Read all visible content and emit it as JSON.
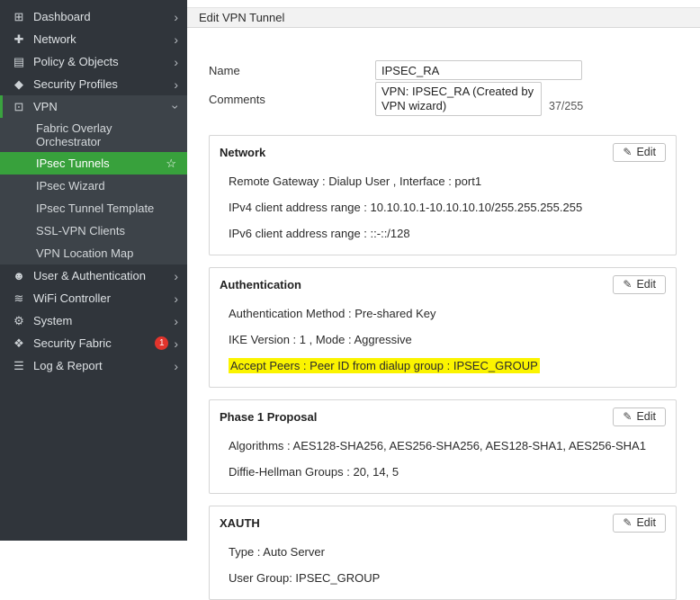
{
  "colors": {
    "sidebar_bg": "#30353b",
    "submenu_bg": "#3d4349",
    "selected_green": "#38a13c",
    "accent_green": "#3aa23f",
    "badge_red": "#e2342c",
    "highlight_yellow": "#fbf400"
  },
  "icons": {
    "dashboard": "⊞",
    "network": "✚",
    "policy": "▤",
    "security_profiles": "◆",
    "vpn": "⊡",
    "user_auth": "☻",
    "wifi": "≋",
    "system": "⚙",
    "security_fabric": "❖",
    "log_report": "☰",
    "chevron": "›",
    "star": "☆",
    "pencil": "✎"
  },
  "sidebar": {
    "items": [
      {
        "label": "Dashboard"
      },
      {
        "label": "Network"
      },
      {
        "label": "Policy & Objects"
      },
      {
        "label": "Security Profiles"
      },
      {
        "label": "VPN"
      },
      {
        "label": "User & Authentication"
      },
      {
        "label": "WiFi Controller"
      },
      {
        "label": "System"
      },
      {
        "label": "Security Fabric",
        "badge": "1"
      },
      {
        "label": "Log & Report"
      }
    ],
    "vpn_submenu": [
      {
        "label": "Fabric Overlay Orchestrator"
      },
      {
        "label": "IPsec Tunnels",
        "selected": true
      },
      {
        "label": "IPsec Wizard"
      },
      {
        "label": "IPsec Tunnel Template"
      },
      {
        "label": "SSL-VPN Clients"
      },
      {
        "label": "VPN Location Map"
      }
    ]
  },
  "header": {
    "title": "Edit VPN Tunnel"
  },
  "form": {
    "name_label": "Name",
    "name_value": "IPSEC_RA",
    "comments_label": "Comments",
    "comments_value": "VPN: IPSEC_RA (Created by VPN wizard)",
    "comments_counter": "37/255"
  },
  "sections": [
    {
      "title": "Network",
      "edit_label": "Edit",
      "lines": [
        {
          "text": "Remote Gateway : Dialup User , Interface : port1"
        },
        {
          "text": "IPv4 client address range : 10.10.10.1-10.10.10.10/255.255.255.255"
        },
        {
          "text": "IPv6 client address range : ::-::/128"
        }
      ]
    },
    {
      "title": "Authentication",
      "edit_label": "Edit",
      "lines": [
        {
          "text": "Authentication Method : Pre-shared Key"
        },
        {
          "text": "IKE Version : 1 , Mode : Aggressive"
        },
        {
          "text": "Accept Peers : Peer ID from dialup group : IPSEC_GROUP",
          "highlight": true
        }
      ]
    },
    {
      "title": "Phase 1 Proposal",
      "edit_label": "Edit",
      "lines": [
        {
          "text": "Algorithms : AES128-SHA256, AES256-SHA256, AES128-SHA1, AES256-SHA1"
        },
        {
          "text": "Diffie-Hellman Groups : 20, 14, 5"
        }
      ]
    },
    {
      "title": "XAUTH",
      "edit_label": "Edit",
      "lines": [
        {
          "text": "Type : Auto Server"
        },
        {
          "text": "User Group: IPSEC_GROUP"
        }
      ]
    }
  ]
}
